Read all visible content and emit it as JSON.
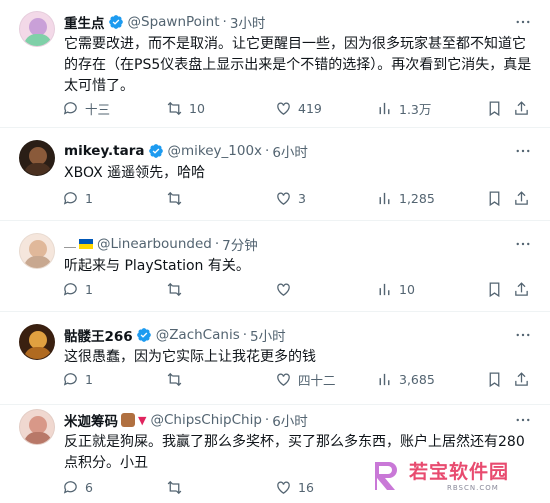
{
  "tweets": [
    {
      "name": "重生点",
      "handle": "@SpawnPoint",
      "time": "3小时",
      "verified": true,
      "text": "它需要改进，而不是取消。让它更醒目一些，因为很多玩家甚至都不知道它的存在（在PS5仪表盘上显示出来是个不错的选择）。再次看到它消失，真是太可惜了。",
      "replies": "十三",
      "reposts": "10",
      "likes": "419",
      "views": "1.3万",
      "avatar_color": "#c9a0d8"
    },
    {
      "name": "mikey.tara",
      "handle": "@mikey_100x",
      "time": "6小时",
      "verified": true,
      "text": "XBOX 遥遥领先，哈哈",
      "replies": "1",
      "reposts": "",
      "likes": "3",
      "views": "1,285",
      "avatar_color": "#3a2a1e"
    },
    {
      "name": "",
      "handle": "@Linearbounded",
      "time": "7分钟",
      "verified": false,
      "text": "听起来与 PlayStation 有关。",
      "replies": "1",
      "reposts": "",
      "likes": "",
      "views": "10",
      "avatar_color": "#e8c8b0"
    },
    {
      "name": "骷髅王266",
      "handle": "@ZachCanis",
      "time": "5小时",
      "verified": true,
      "text": "这很愚蠢，因为它实际上让我花更多的钱",
      "replies": "1",
      "reposts": "",
      "likes": "四十二",
      "views": "3,685",
      "avatar_color": "#7a4a1a"
    },
    {
      "name": "米迦筹码",
      "handle": "@ChipsChipChip",
      "time": "6小时",
      "verified": false,
      "text": "反正就是狗屎。我赢了那么多奖杯，买了那么多东西，账户上居然还有280点积分。小丑",
      "replies": "6",
      "reposts": "",
      "likes": "16",
      "views": "",
      "avatar_color": "#d8a8a0"
    }
  ],
  "watermark": {
    "title": "若宝软件园",
    "subtitle": "RBSCN.COM"
  },
  "colors": {
    "verified": "#1d9bf0",
    "muted": "#536471",
    "divider": "#eff3f4"
  }
}
